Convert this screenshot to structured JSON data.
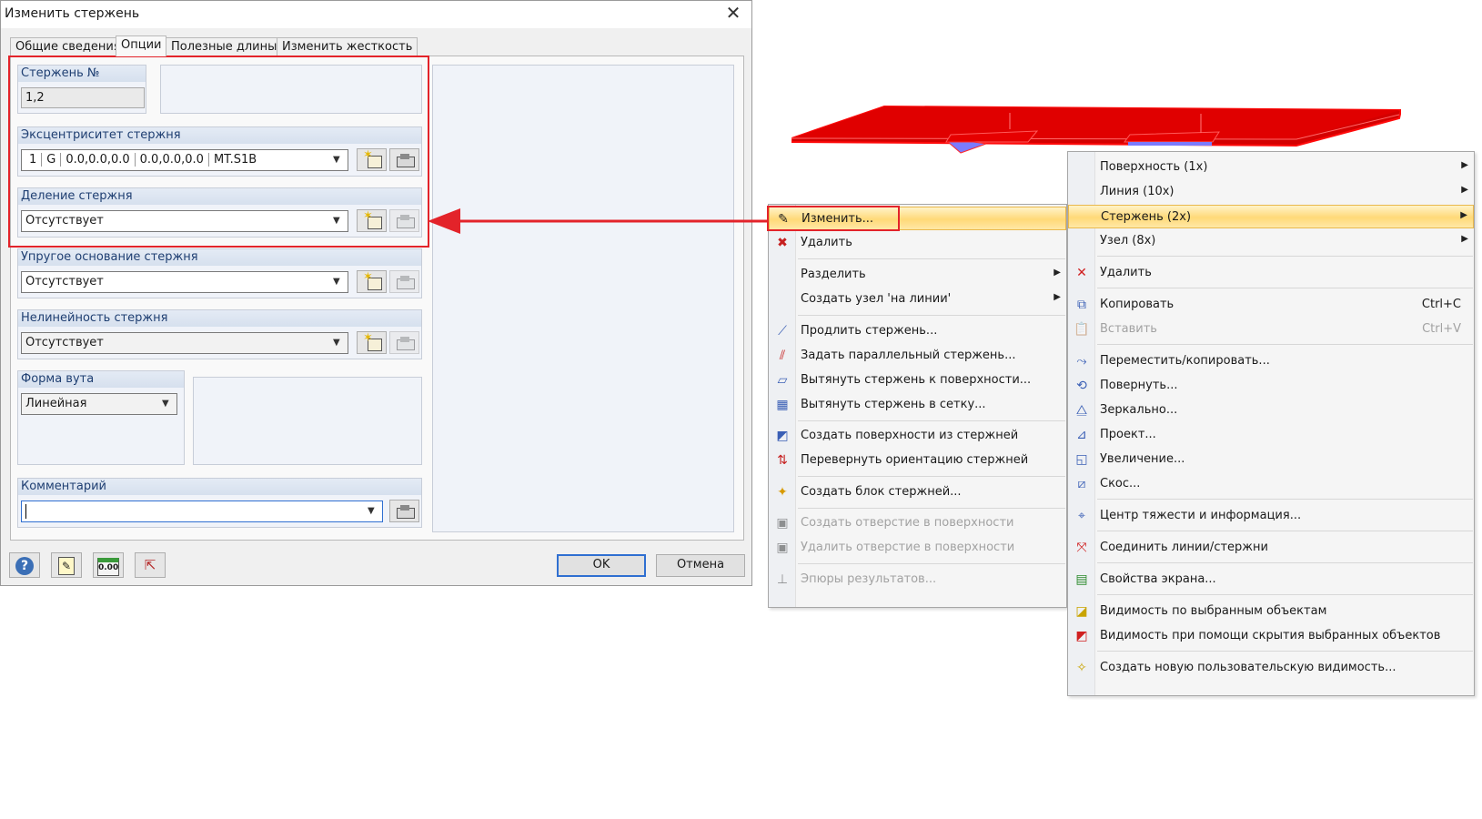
{
  "dialog": {
    "title": "Изменить стержень",
    "close_glyph": "✕",
    "tabs": [
      "Общие сведения",
      "Опции",
      "Полезные длины",
      "Изменить жесткость"
    ],
    "active_tab": "Опции",
    "member_no": {
      "label": "Стержень №",
      "value": "1,2"
    },
    "eccentricity": {
      "label": "Эксцентриситет стержня",
      "segments": [
        "1",
        "G",
        "0.0,0.0,0.0",
        "0.0,0.0,0.0",
        "MT.S1B"
      ]
    },
    "division": {
      "label": "Деление стержня",
      "value": "Отсутствует"
    },
    "elastic": {
      "label": "Упругое основание стержня",
      "value": "Отсутствует"
    },
    "nonlinearity": {
      "label": "Нелинейность стержня",
      "value": "Отсутствует"
    },
    "taper": {
      "label": "Форма вута",
      "value": "Линейная"
    },
    "comment": {
      "label": "Комментарий",
      "value": ""
    },
    "buttons": {
      "ok": "OK",
      "cancel": "Отмена"
    },
    "tool_icons": [
      "help-icon",
      "edit-notes-icon",
      "units-icon",
      "pointer-select-icon"
    ],
    "units_text": "0.00"
  },
  "highlight_color": "#e3232a",
  "model_color": "#e30000",
  "context_menu_left": {
    "items": [
      {
        "label": "Изменить...",
        "icon": "edit-member-icon",
        "state": "hot"
      },
      {
        "label": "Удалить",
        "icon": "delete-member-icon"
      },
      {
        "label": "Разделить",
        "submenu": true
      },
      {
        "label": "Создать узел 'на линии'",
        "submenu": true
      },
      {
        "label": "Продлить стержень...",
        "icon": "extend-icon"
      },
      {
        "label": "Задать параллельный стержень...",
        "icon": "parallel-icon"
      },
      {
        "label": "Вытянуть стержень к поверхности...",
        "icon": "extrude-surface-icon"
      },
      {
        "label": "Вытянуть стержень в сетку...",
        "icon": "extrude-grid-icon"
      },
      {
        "label": "Создать поверхности из стержней",
        "icon": "surface-from-members-icon"
      },
      {
        "label": "Перевернуть ориентацию стержней",
        "icon": "flip-orientation-icon"
      },
      {
        "label": "Создать блок стержней...",
        "icon": "block-icon"
      },
      {
        "label": "Создать отверстие в поверхности",
        "icon": "opening-icon",
        "disabled": true
      },
      {
        "label": "Удалить отверстие в поверхности",
        "icon": "delete-opening-icon",
        "disabled": true
      },
      {
        "label": "Эпюры результатов...",
        "icon": "result-diagram-icon",
        "disabled": true
      }
    ]
  },
  "context_menu_right": {
    "items": [
      {
        "label": "Поверхность (1x)",
        "submenu": true
      },
      {
        "label": "Линия (10x)",
        "submenu": true
      },
      {
        "label": "Стержень (2x)",
        "submenu": true,
        "state": "hot"
      },
      {
        "label": "Узел (8x)",
        "submenu": true
      },
      {
        "label": "Удалить",
        "icon": "delete-icon"
      },
      {
        "label": "Копировать",
        "icon": "copy-icon",
        "shortcut": "Ctrl+C"
      },
      {
        "label": "Вставить",
        "icon": "paste-icon",
        "shortcut": "Ctrl+V",
        "disabled": true
      },
      {
        "label": "Переместить/копировать...",
        "icon": "move-copy-icon"
      },
      {
        "label": "Повернуть...",
        "icon": "rotate-icon"
      },
      {
        "label": "Зеркально...",
        "icon": "mirror-icon"
      },
      {
        "label": "Проект...",
        "icon": "project-icon"
      },
      {
        "label": "Увеличение...",
        "icon": "scale-icon"
      },
      {
        "label": "Скос...",
        "icon": "shear-icon"
      },
      {
        "label": "Центр тяжести и информация...",
        "icon": "centroid-icon"
      },
      {
        "label": "Соединить линии/стержни",
        "icon": "connect-icon"
      },
      {
        "label": "Свойства экрана...",
        "icon": "display-properties-icon"
      },
      {
        "label": "Видимость по выбранным объектам",
        "icon": "visibility-selected-icon"
      },
      {
        "label": "Видимость при помощи скрытия выбранных объектов",
        "icon": "visibility-hide-icon"
      },
      {
        "label": "Создать новую пользовательскую видимость...",
        "icon": "new-visibility-icon"
      }
    ]
  }
}
